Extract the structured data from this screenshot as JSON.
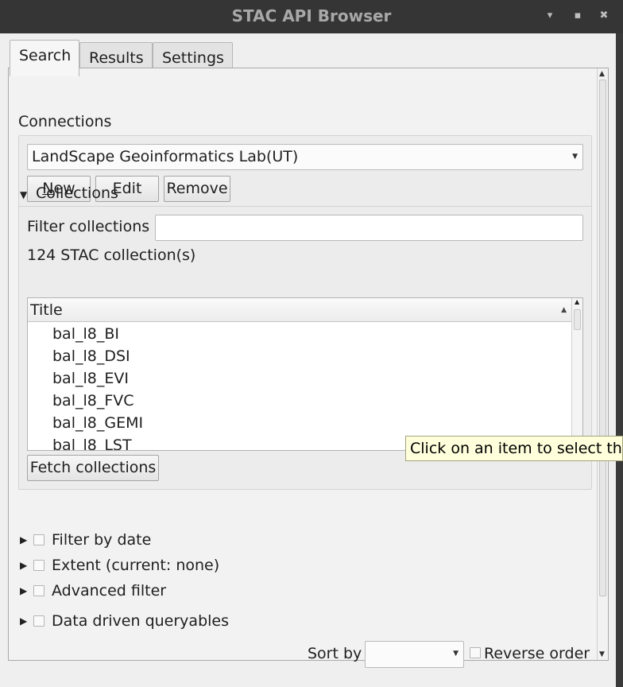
{
  "window": {
    "title": "STAC API Browser",
    "minimize_glyph": "▾",
    "maximize_glyph": "▪",
    "close_glyph": "✖"
  },
  "tabs": [
    {
      "label": "Search",
      "active": true
    },
    {
      "label": "Results",
      "active": false
    },
    {
      "label": "Settings",
      "active": false
    }
  ],
  "connections": {
    "label": "Connections",
    "selected": "LandScape Geoinformatics Lab(UT)",
    "new_label": "New",
    "edit_label": "Edit",
    "remove_label": "Remove"
  },
  "collections": {
    "label": "Collections",
    "filter_label": "Filter collections",
    "filter_value": "",
    "count_text": "124 STAC collection(s)",
    "column_title": "Title",
    "items": [
      "bal_l8_BI",
      "bal_l8_DSI",
      "bal_l8_EVI",
      "bal_l8_FVC",
      "bal_l8_GEMI",
      "bal_l8_LST"
    ],
    "fetch_label": "Fetch collections"
  },
  "sections": [
    {
      "label": "Filter by date"
    },
    {
      "label": "Extent (current: none)"
    },
    {
      "label": "Advanced filter"
    },
    {
      "label": "Data driven queryables"
    }
  ],
  "sort": {
    "label": "Sort by",
    "value": "",
    "reverse_label": "Reverse order"
  },
  "tooltip": {
    "text": "Click on an item to select the"
  },
  "colors": {
    "tooltip_bg": "#ffffdc",
    "window_bg": "#efefef",
    "titlebar_bg": "#353535"
  }
}
